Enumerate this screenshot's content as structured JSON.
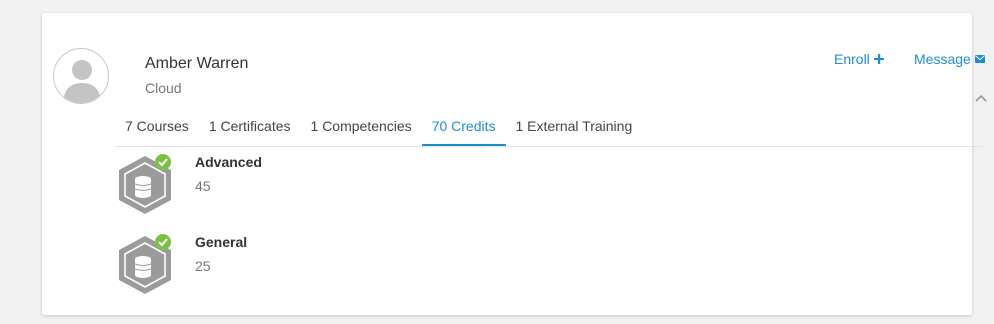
{
  "profile": {
    "name": "Amber Warren",
    "subtitle": "Cloud",
    "avatar_icon": "user-placeholder-icon"
  },
  "actions": {
    "enroll_label": "Enroll",
    "enroll_icon": "plus-icon",
    "message_label": "Message",
    "message_icon": "envelope-icon",
    "collapse_icon": "chevron-up-icon"
  },
  "tabs": [
    {
      "label": "7 Courses",
      "active": false
    },
    {
      "label": "1 Certificates",
      "active": false
    },
    {
      "label": "1 Competencies",
      "active": false
    },
    {
      "label": "70 Credits",
      "active": true
    },
    {
      "label": "1 External Training",
      "active": false
    }
  ],
  "credits": [
    {
      "label": "Advanced",
      "value": "45",
      "icon": "credits-coin-stack-icon",
      "status_icon": "check-icon"
    },
    {
      "label": "General",
      "value": "25",
      "icon": "credits-coin-stack-icon",
      "status_icon": "check-icon"
    }
  ],
  "colors": {
    "accent": "#1f8dc9",
    "badge_gray": "#9b9b9b",
    "check_green": "#7dc142"
  }
}
